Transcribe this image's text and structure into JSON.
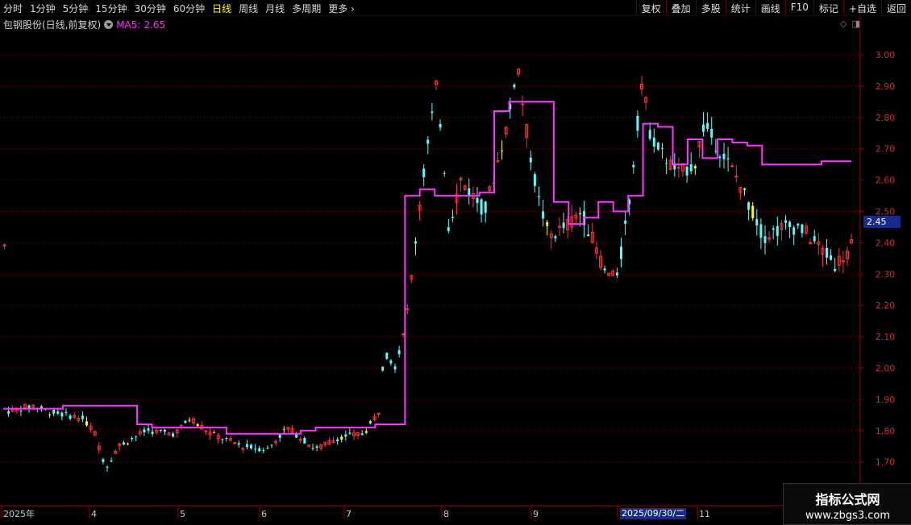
{
  "toolbar": {
    "periods": [
      "分时",
      "1分钟",
      "5分钟",
      "15分钟",
      "30分钟",
      "60分钟",
      "日线",
      "周线",
      "月线",
      "多周期",
      "更多"
    ],
    "active_period": "日线",
    "right_buttons": [
      "复权",
      "叠加",
      "多股",
      "统计",
      "画线",
      "F10",
      "标记",
      "+自选",
      "返回"
    ]
  },
  "header": {
    "stock_title": "包钢股份(日线,前复权)",
    "ma_label": "MA5:",
    "ma_value": "2.65"
  },
  "price_tag": "2.45",
  "date_tag": "2025/09/30/二",
  "watermark": {
    "line1": "指标公式网",
    "line2": "www.zbgs3.com"
  },
  "colors": {
    "up": "#ff3232",
    "down": "#54ffff",
    "highlight": "#ffff00",
    "ma": "#ff33ff",
    "axis": "#a00000"
  },
  "chart_data": {
    "type": "candlestick",
    "y_ticks": [
      "3.00",
      "2.90",
      "2.80",
      "2.70",
      "2.60",
      "2.50",
      "2.40",
      "2.30",
      "2.20",
      "2.10",
      "2.00",
      "1.90",
      "1.80",
      "1.70"
    ],
    "ylim": [
      1.64,
      3.07
    ],
    "x_labels": [
      "2025年",
      "4",
      "5",
      "6",
      "7",
      "8",
      "9",
      "",
      "11"
    ],
    "ma_series_name": "MA5",
    "ma_series": [
      1.87,
      1.87,
      1.87,
      1.87,
      1.88,
      1.88,
      1.88,
      1.88,
      1.88,
      1.82,
      1.81,
      1.81,
      1.81,
      1.81,
      1.81,
      1.79,
      1.79,
      1.79,
      1.79,
      1.79,
      1.8,
      1.81,
      1.81,
      1.81,
      1.81,
      1.82,
      1.82,
      2.55,
      2.57,
      2.55,
      2.55,
      2.55,
      2.56,
      2.82,
      2.85,
      2.85,
      2.85,
      2.53,
      2.46,
      2.48,
      2.53,
      2.5,
      2.55,
      2.78,
      2.77,
      2.65,
      2.73,
      2.67,
      2.73,
      2.72,
      2.71,
      2.65,
      2.65,
      2.65,
      2.65,
      2.66,
      2.66,
      2.66
    ],
    "price_range": {
      "high": 3.07,
      "low": 1.62,
      "last": 2.39
    }
  }
}
